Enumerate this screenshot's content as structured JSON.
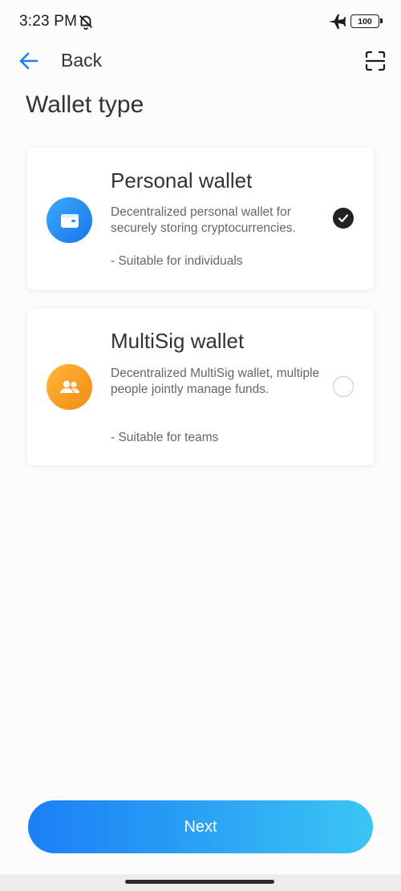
{
  "status_bar": {
    "time": "3:23 PM",
    "icons": [
      "bell-off-icon",
      "airplane-icon",
      "battery-icon"
    ],
    "battery_level": "100"
  },
  "nav": {
    "back_label": "Back",
    "back_icon": "arrow-left-icon",
    "action_icon": "scan-icon",
    "accent_color": "#1a7ff5"
  },
  "page": {
    "title": "Wallet type"
  },
  "wallet_options": [
    {
      "title": "Personal wallet",
      "description": "Decentralized personal wallet for securely storing cryptocurrencies.",
      "suitable": "- Suitable for individuals",
      "icon": "wallet-icon",
      "icon_color": "#1f8cf0",
      "selected": true
    },
    {
      "title": "MultiSig wallet",
      "description": "Decentralized MultiSig wallet, multiple people jointly manage funds.",
      "suitable": "- Suitable for teams",
      "icon": "people-icon",
      "icon_color": "#f7a125",
      "selected": false
    }
  ],
  "footer": {
    "next_label": "Next"
  }
}
